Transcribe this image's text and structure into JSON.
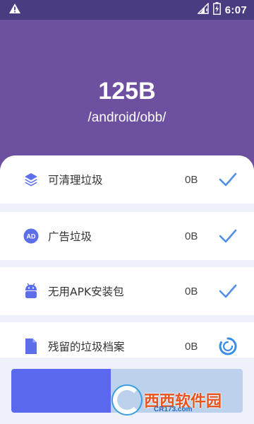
{
  "status_bar": {
    "time": "6:07",
    "icons": [
      "warning-icon",
      "signal-icon",
      "battery-icon"
    ]
  },
  "header": {
    "size": "125B",
    "path": "/android/obb/"
  },
  "items": [
    {
      "label": "可清理垃圾",
      "size": "0B",
      "icon": "layers-icon",
      "status": "done"
    },
    {
      "label": "广告垃圾",
      "size": "0B",
      "icon": "ad-icon",
      "status": "done"
    },
    {
      "label": "无用APK安装包",
      "size": "0B",
      "icon": "android-icon",
      "status": "done"
    },
    {
      "label": "残留的垃圾档案",
      "size": "0B",
      "icon": "file-icon",
      "status": "loading"
    }
  ],
  "progress": {
    "fraction": 0.43
  },
  "watermark": {
    "brand": "西西软件园",
    "site": "CR173.com"
  },
  "colors": {
    "status_bar": "#4b3b80",
    "header": "#6e50a0",
    "accent": "#4f8fe6",
    "progress_fill": "#5a68ee",
    "progress_track": "#bcd2ec"
  }
}
